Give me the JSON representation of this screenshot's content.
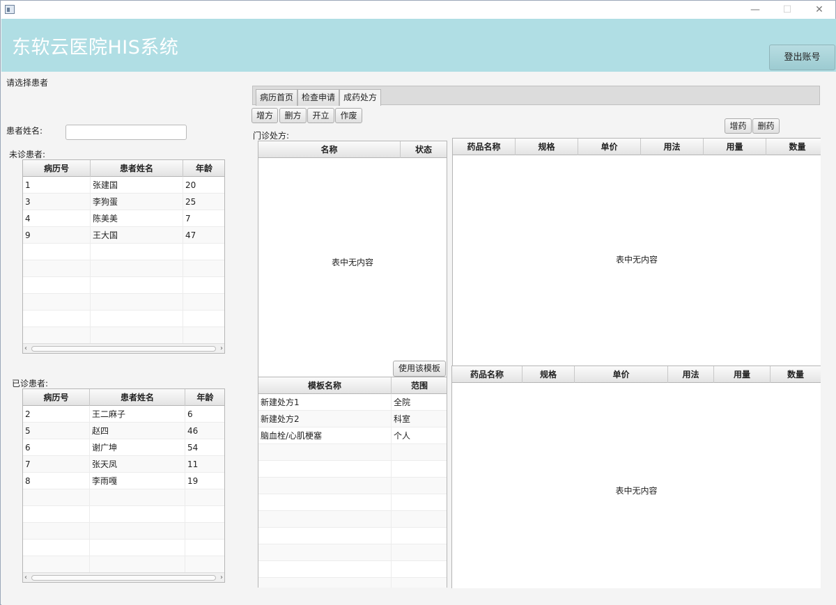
{
  "window": {
    "minimize": "—",
    "maximize": "☐",
    "close": "✕"
  },
  "header": {
    "title": "东软云医院HIS系统",
    "logout_label": "登出账号"
  },
  "left": {
    "select_patient_label": "请选择患者",
    "patient_name_label": "患者姓名:",
    "patient_name_value": "",
    "undiagnosed_label": "未诊患者:",
    "diagnosed_label": "已诊患者:",
    "columns": [
      "病历号",
      "患者姓名",
      "年龄"
    ],
    "undiagnosed_rows": [
      [
        "1",
        "张建国",
        "20"
      ],
      [
        "3",
        "李狗蛋",
        "25"
      ],
      [
        "4",
        "陈美美",
        "7"
      ],
      [
        "9",
        "王大国",
        "47"
      ]
    ],
    "diagnosed_rows": [
      [
        "2",
        "王二麻子",
        "6"
      ],
      [
        "5",
        "赵四",
        "46"
      ],
      [
        "6",
        "谢广坤",
        "54"
      ],
      [
        "7",
        "张天凤",
        "11"
      ],
      [
        "8",
        "李雨嘎",
        "19"
      ]
    ]
  },
  "tabs": [
    "病历首页",
    "检查申请",
    "成药处方"
  ],
  "toolbar": {
    "add": "增方",
    "delete": "删方",
    "open": "开立",
    "void": "作废"
  },
  "drug_buttons": {
    "add": "增药",
    "delete": "删药"
  },
  "prescription": {
    "label": "门诊处方:",
    "columns": [
      "名称",
      "状态"
    ],
    "empty_text": "表中无内容"
  },
  "drugs_top": {
    "columns": [
      "药品名称",
      "规格",
      "单价",
      "用法",
      "用量",
      "数量"
    ],
    "empty_text": "表中无内容"
  },
  "template": {
    "use_button": "使用该模板",
    "columns": [
      "模板名称",
      "范围"
    ],
    "rows": [
      [
        "新建处方1",
        "全院"
      ],
      [
        "新建处方2",
        "科室"
      ],
      [
        "脑血栓/心肌梗塞",
        "个人"
      ]
    ]
  },
  "drugs_bottom": {
    "columns": [
      "药品名称",
      "规格",
      "单价",
      "用法",
      "用量",
      "数量"
    ],
    "empty_text": "表中无内容"
  }
}
